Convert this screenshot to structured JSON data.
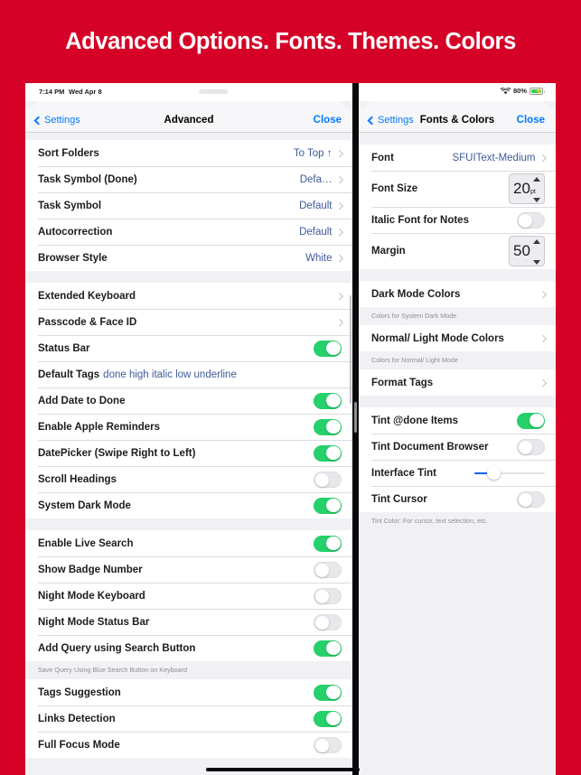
{
  "promo": {
    "headline": "Advanced Options. Fonts. Themes. Colors",
    "background_color": "#D50127"
  },
  "status_bar": {
    "time": "7:14 PM",
    "date": "Wed Apr 8",
    "wifi_icon": "wifi-icon",
    "battery_percent": "80%",
    "battery_icon": "battery-charging-icon"
  },
  "left_panel": {
    "nav": {
      "back_icon": "chevron-left-icon",
      "back_label": "Settings",
      "title": "Advanced",
      "close_label": "Close"
    },
    "sections": [
      {
        "rows": [
          {
            "label": "Sort Folders",
            "value": "To Top ↑",
            "type": "disclosure"
          },
          {
            "label": "Task Symbol (Done)",
            "value": "Defa…",
            "type": "disclosure"
          },
          {
            "label": "Task Symbol",
            "value": "Default",
            "type": "disclosure"
          },
          {
            "label": "Autocorrection",
            "value": "Default",
            "type": "disclosure"
          },
          {
            "label": "Browser Style",
            "value": "White",
            "type": "disclosure"
          }
        ]
      },
      {
        "rows": [
          {
            "label": "Extended Keyboard",
            "value": "",
            "type": "disclosure"
          },
          {
            "label": "Passcode & Face ID",
            "value": "",
            "type": "disclosure"
          },
          {
            "label": "Status Bar",
            "type": "toggle",
            "on": true
          },
          {
            "label": "Default Tags",
            "value": "done high italic low underline",
            "type": "inline-value"
          },
          {
            "label": "Add Date to Done",
            "type": "toggle",
            "on": true
          },
          {
            "label": "Enable Apple Reminders",
            "type": "toggle",
            "on": true
          },
          {
            "label": "DatePicker (Swipe Right to Left)",
            "type": "toggle",
            "on": true
          },
          {
            "label": "Scroll Headings",
            "type": "toggle",
            "on": false
          },
          {
            "label": "System Dark Mode",
            "type": "toggle",
            "on": true
          }
        ]
      },
      {
        "rows": [
          {
            "label": "Enable Live Search",
            "type": "toggle",
            "on": true
          },
          {
            "label": "Show Badge Number",
            "type": "toggle",
            "on": false
          },
          {
            "label": "Night Mode Keyboard",
            "type": "toggle",
            "on": false
          },
          {
            "label": "Night Mode Status Bar",
            "type": "toggle",
            "on": false
          },
          {
            "label": "Add Query using Search Button",
            "type": "toggle",
            "on": true
          }
        ],
        "footnote": "Save Query Using Blue Search Button on Keyboard"
      },
      {
        "rows": [
          {
            "label": "Tags Suggestion",
            "type": "toggle",
            "on": true
          },
          {
            "label": "Links Detection",
            "type": "toggle",
            "on": true
          },
          {
            "label": "Full Focus Mode",
            "type": "toggle",
            "on": false
          }
        ]
      }
    ]
  },
  "right_panel": {
    "nav": {
      "back_icon": "chevron-left-icon",
      "back_label": "Settings",
      "title": "Fonts & Colors",
      "close_label": "Close"
    },
    "sections": [
      {
        "rows": [
          {
            "label": "Font",
            "value": "SFUIText-Medium",
            "type": "disclosure"
          },
          {
            "label": "Font Size",
            "type": "stepper",
            "number": "20",
            "unit": "pt"
          },
          {
            "label": "Italic Font for Notes",
            "type": "toggle",
            "on": false
          },
          {
            "label": "Margin",
            "type": "stepper",
            "number": "50",
            "unit": ""
          }
        ]
      },
      {
        "rows": [
          {
            "label": "Dark Mode Colors",
            "type": "disclosure"
          }
        ],
        "footnote": "Colors for System Dark Mode"
      },
      {
        "rows": [
          {
            "label": "Normal/ Light Mode Colors",
            "type": "disclosure"
          }
        ],
        "footnote": "Colors for Normal/ Light Mode"
      },
      {
        "rows": [
          {
            "label": "Format Tags",
            "type": "disclosure"
          }
        ]
      },
      {
        "rows": [
          {
            "label": "Tint @done Items",
            "type": "toggle",
            "on": true
          },
          {
            "label": "Tint Document Browser",
            "type": "toggle",
            "on": false
          },
          {
            "label": "Interface Tint",
            "type": "slider",
            "value_percent": 20
          },
          {
            "label": "Tint Cursor",
            "type": "toggle",
            "on": false
          }
        ],
        "footnote": "Tint Color: For cursor, text selection, etc."
      }
    ]
  },
  "colors": {
    "accent_blue": "#007aff",
    "value_blue": "#3c5a9a",
    "toggle_on_green": "#26d06a",
    "promo_red": "#D50127",
    "slider_blue": "#0a60ff"
  }
}
